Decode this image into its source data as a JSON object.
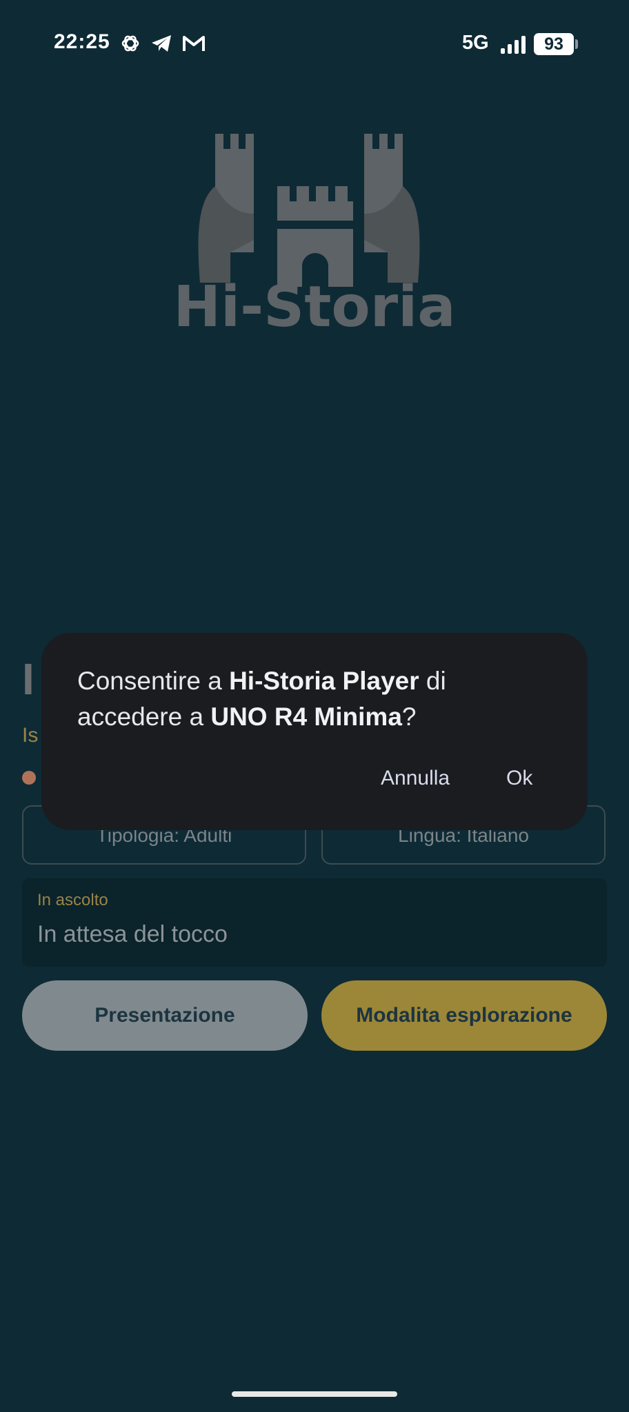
{
  "status_bar": {
    "time": "22:25",
    "network": "5G",
    "battery": "93",
    "left_icons": [
      "openai-icon",
      "telegram-icon",
      "gmail-icon"
    ]
  },
  "app": {
    "logo_text": "Hi-Storia",
    "partial_title": "I",
    "partial_subtitle": "Is",
    "type_chip": "Tipologia: Adulti",
    "language_chip": "Lingua: Italiano",
    "listening": {
      "label": "In ascolto",
      "value": "In attesa del tocco"
    },
    "presentation_button": "Presentazione",
    "exploration_button": "Modalita esplorazione"
  },
  "dialog": {
    "text_1": "Consentire a ",
    "app_name": "Hi-Storia Player",
    "text_2": " di accedere a ",
    "device_name": "UNO R4 Minima",
    "text_3": "?",
    "cancel_label": "Annulla",
    "ok_label": "Ok"
  },
  "colors": {
    "background": "#0e2a35",
    "dialog": "#1b1c20",
    "accent_gold": "#9c8738"
  }
}
